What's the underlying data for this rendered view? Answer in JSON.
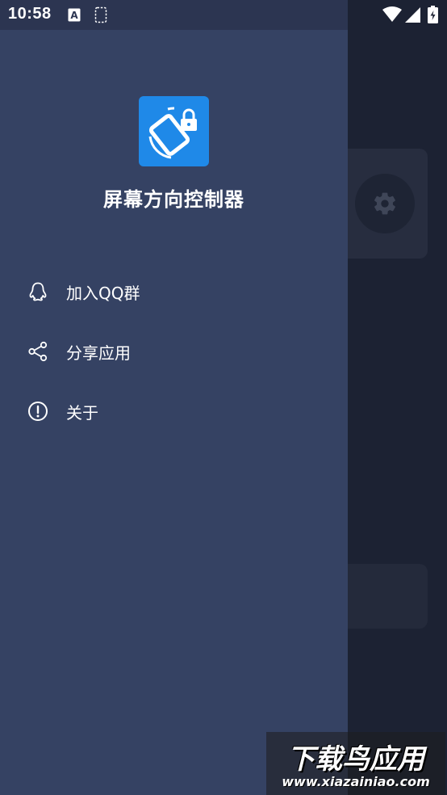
{
  "status_bar": {
    "time": "10:58",
    "icons": [
      "text-a-icon",
      "screen-rotation-icon",
      "wifi-icon",
      "signal-icon",
      "battery-icon"
    ]
  },
  "background": {
    "icons": [
      "gear-icon"
    ]
  },
  "drawer": {
    "app_name": "屏幕方向控制器",
    "logo_icon": "rotation-lock-icon",
    "menu": [
      {
        "label": "加入QQ群",
        "icon": "qq-icon"
      },
      {
        "label": "分享应用",
        "icon": "share-icon"
      },
      {
        "label": "关于",
        "icon": "info-icon"
      }
    ]
  },
  "watermark": {
    "title": "下载鸟应用",
    "url": "www.xiazainiao.com"
  },
  "colors": {
    "drawer_bg": "#354263",
    "status_bar": "#2c3551",
    "scrim": "#1c2233",
    "logo_bg": "#1f89e8"
  }
}
